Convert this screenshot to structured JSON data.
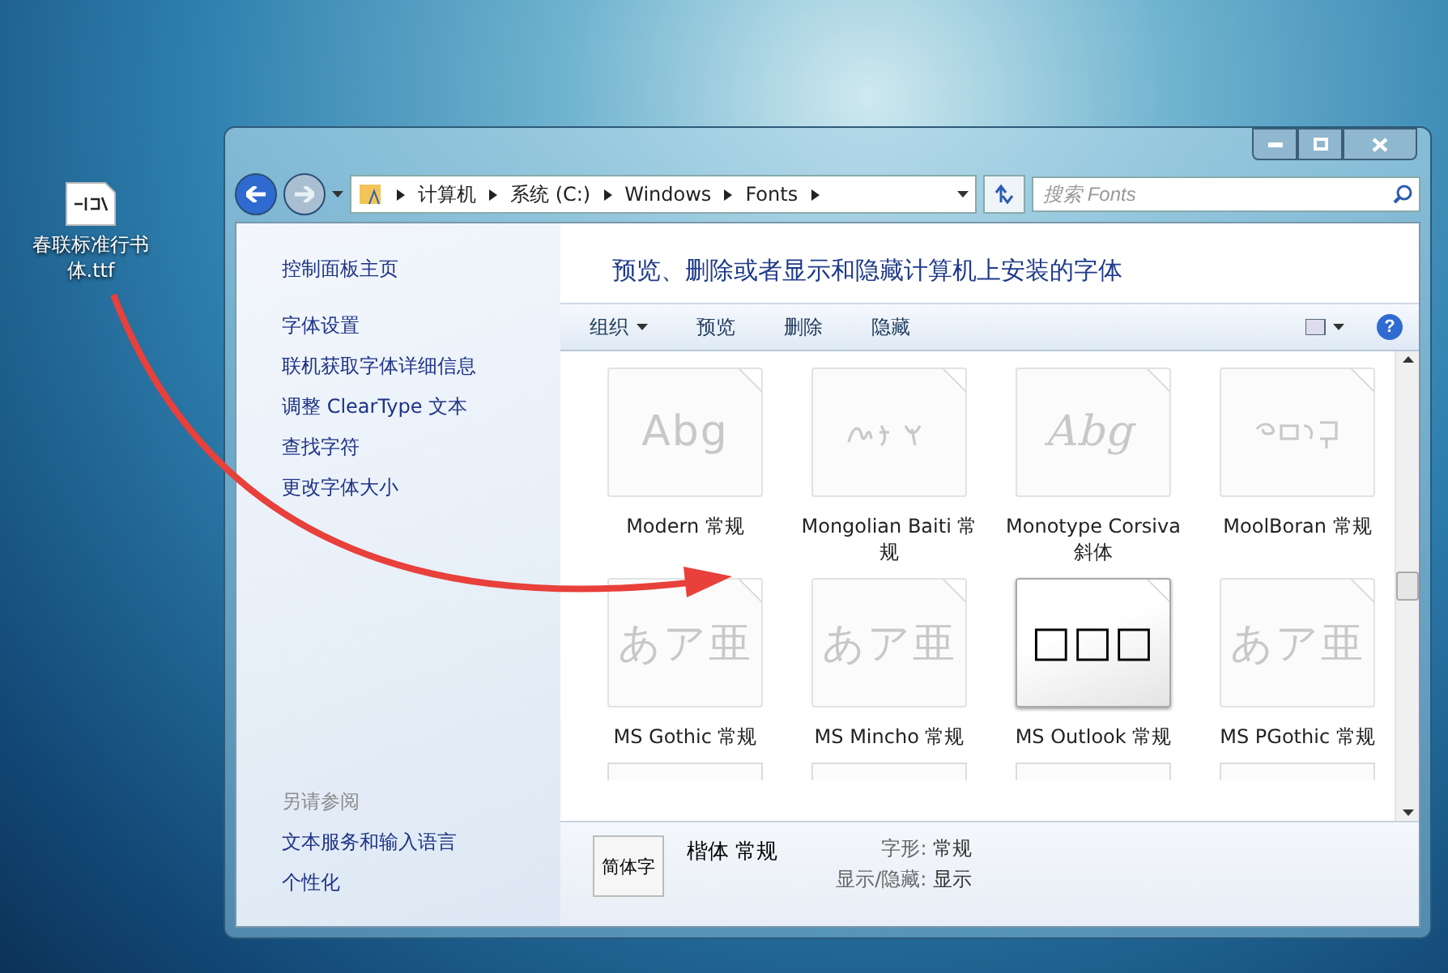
{
  "desktop_icon": {
    "label": "春联标准行书体.ttf"
  },
  "nav": {
    "path": [
      "计算机",
      "系统 (C:)",
      "Windows",
      "Fonts"
    ],
    "search": {
      "placeholder": "搜索 Fonts"
    }
  },
  "sidebar": {
    "home": "控制面板主页",
    "items": [
      "字体设置",
      "联机获取字体详细信息",
      "调整 ClearType 文本",
      "查找字符",
      "更改字体大小"
    ],
    "see_also_heading": "另请参阅",
    "see_also": [
      "文本服务和输入语言",
      "个性化"
    ]
  },
  "heading": "预览、删除或者显示和隐藏计算机上安装的字体",
  "toolbar": {
    "buttons": [
      {
        "label": "组织",
        "dropdown": true
      },
      {
        "label": "预览",
        "dropdown": false
      },
      {
        "label": "删除",
        "dropdown": false
      },
      {
        "label": "隐藏",
        "dropdown": false
      }
    ],
    "help": "?"
  },
  "fonts": [
    {
      "name": "Modern 常规",
      "kind": "text",
      "preview": "Abg",
      "italic": false,
      "hidden": true
    },
    {
      "name": "Mongolian Baiti 常规",
      "kind": "glyphs",
      "italic": false,
      "hidden": true
    },
    {
      "name": "Monotype Corsiva 斜体",
      "kind": "text",
      "preview": "Abg",
      "italic": true,
      "hidden": true
    },
    {
      "name": "MoolBoran 常规",
      "kind": "glyphs",
      "italic": false,
      "hidden": true
    },
    {
      "name": "MS Gothic 常规",
      "kind": "text",
      "preview": "あア亜",
      "italic": false,
      "hidden": true
    },
    {
      "name": "MS Mincho 常规",
      "kind": "text",
      "preview": "あア亜",
      "italic": false,
      "hidden": true
    },
    {
      "name": "MS Outlook 常规",
      "kind": "text",
      "preview": "□□□",
      "italic": false,
      "hidden": false
    },
    {
      "name": "MS PGothic 常规",
      "kind": "text",
      "preview": "あア亜",
      "italic": false,
      "hidden": true
    }
  ],
  "details": {
    "preview": "简体字",
    "name": "楷体 常规",
    "fields": [
      {
        "label": "字形:",
        "value": "常规"
      },
      {
        "label": "显示/隐藏:",
        "value": "显示"
      }
    ]
  }
}
